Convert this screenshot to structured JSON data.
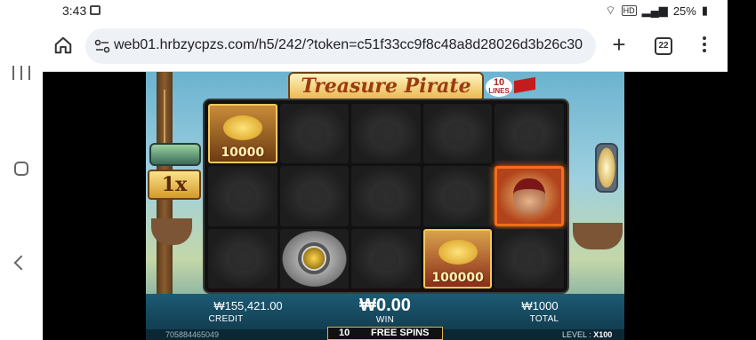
{
  "status_bar": {
    "time": "3:43",
    "hd_label": "HD",
    "battery": "25%"
  },
  "browser": {
    "url": "web01.hrbzycpzs.com/h5/242/?token=c51f33cc9f8c48a8d28026d3b26c30",
    "tab_count": "22"
  },
  "game": {
    "title": "Treasure Pirate",
    "lines_count": "10",
    "lines_label": "LINES",
    "multiplier": "1x",
    "reels": [
      [
        {
          "symbol": "coin-bag",
          "value": "10000"
        },
        {
          "symbol": "skull"
        },
        {
          "symbol": "skull"
        },
        {
          "symbol": "skull"
        },
        {
          "symbol": "skull"
        }
      ],
      [
        {
          "symbol": "skull"
        },
        {
          "symbol": "skull"
        },
        {
          "symbol": "skull"
        },
        {
          "symbol": "skull"
        },
        {
          "symbol": "pirate"
        }
      ],
      [
        {
          "symbol": "skull"
        },
        {
          "symbol": "silver-sword-coin"
        },
        {
          "symbol": "skull"
        },
        {
          "symbol": "coin-chest",
          "value": "100000"
        },
        {
          "symbol": "skull"
        }
      ]
    ],
    "credit_value": "₩155,421.00",
    "credit_label": "CREDIT",
    "win_value": "₩0.00",
    "win_label": "WIN",
    "total_value": "₩1000",
    "total_label": "TOTAL",
    "account_id": "705884465049",
    "free_spins_count": "10",
    "free_spins_label": "FREE SPINS",
    "level_label": "LEVEL :",
    "level_value": "X100"
  }
}
